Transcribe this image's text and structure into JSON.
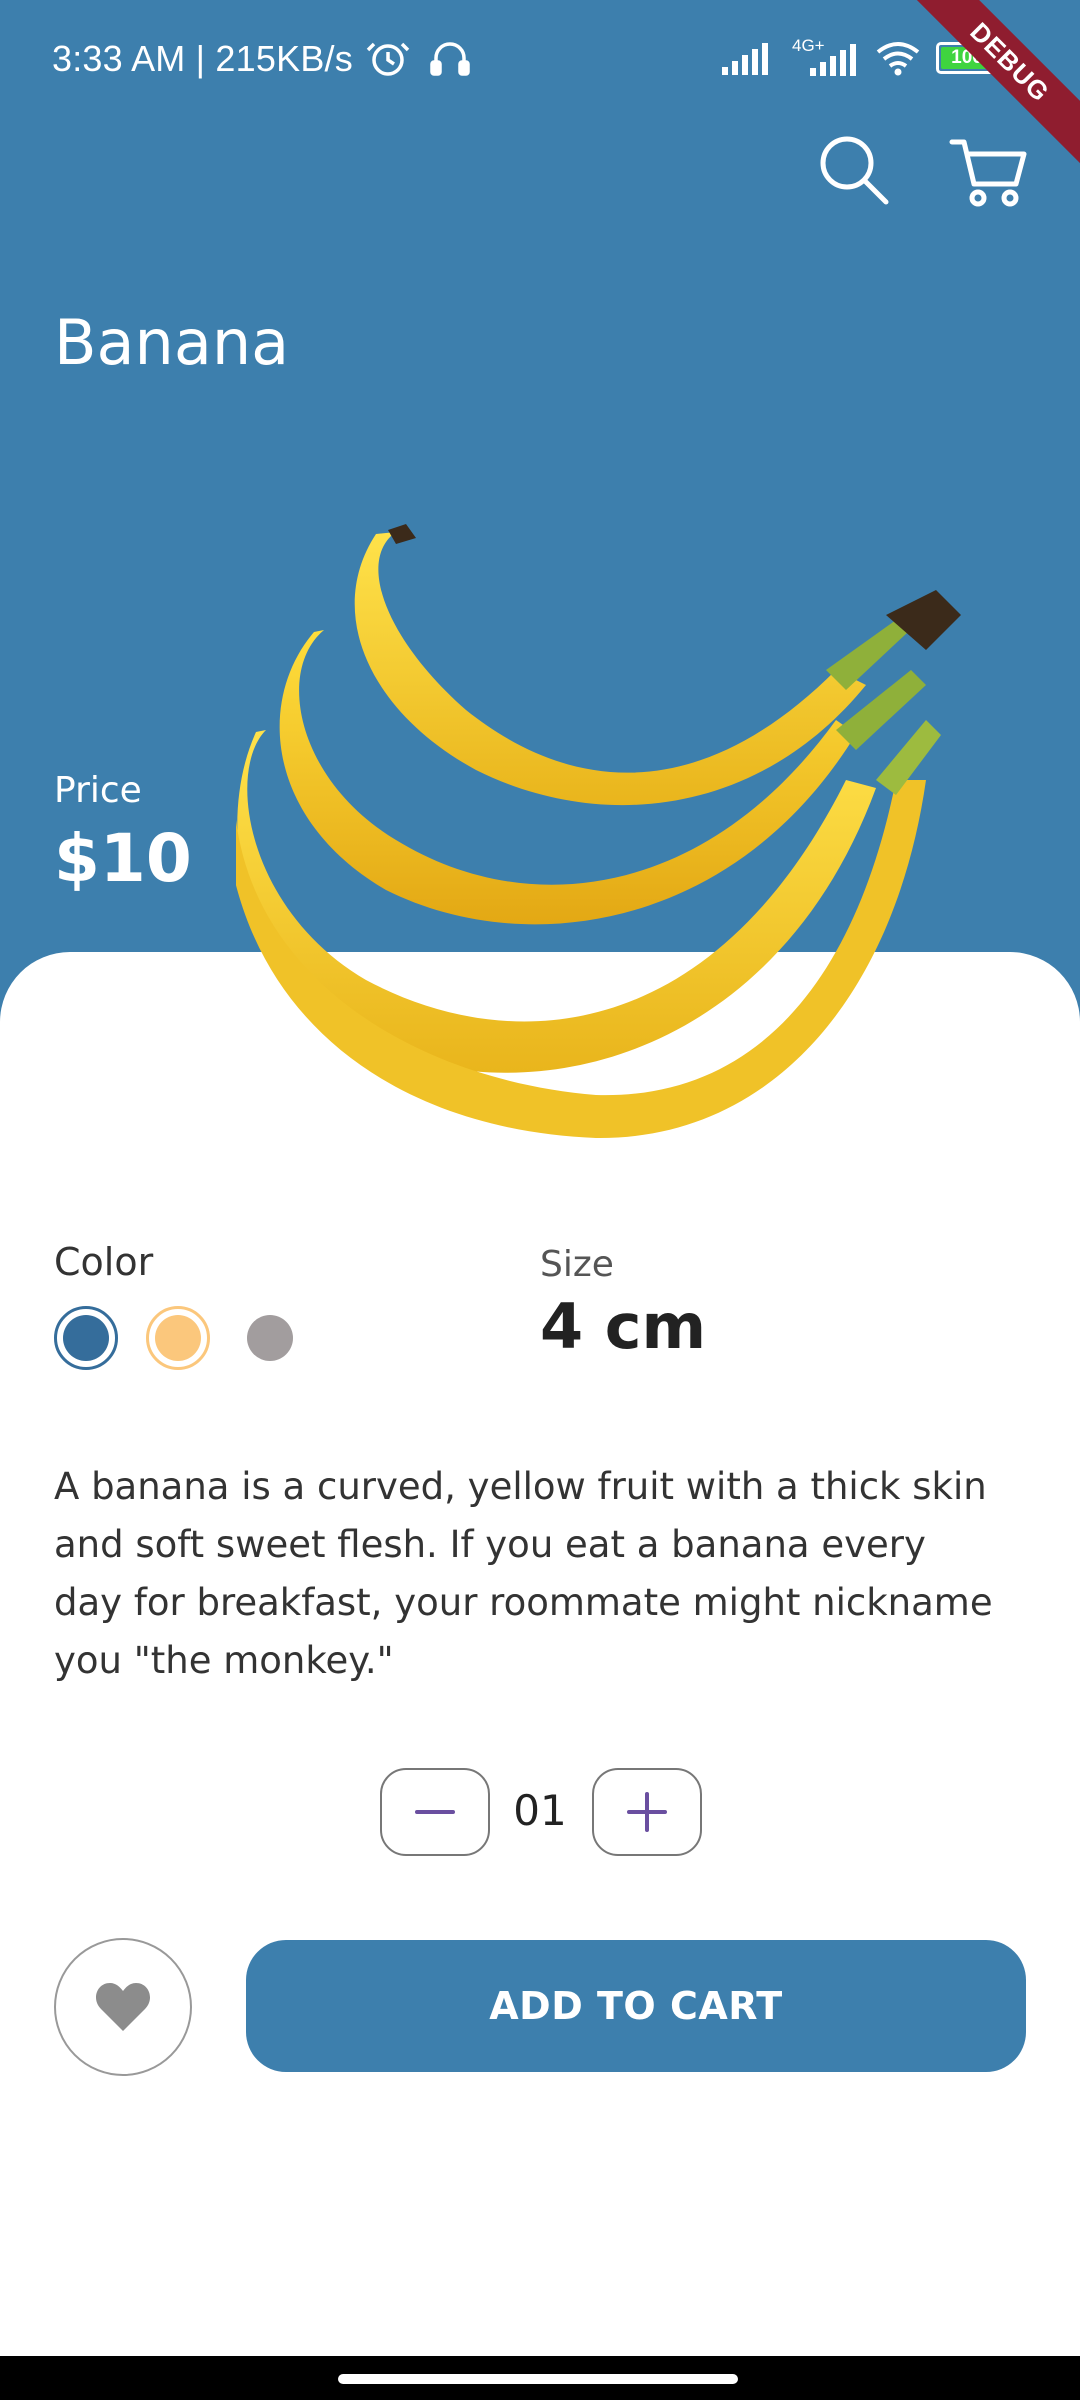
{
  "status_bar": {
    "time_speed": "3:33 AM | 215KB/s",
    "network": "4G+",
    "battery": "100",
    "debug_banner": "DEBUG"
  },
  "product": {
    "title": "Banana",
    "price_label": "Price",
    "price_value": "$10",
    "color_label": "Color",
    "colors": [
      "#356d9b",
      "#fbc77c",
      "#a29d9e"
    ],
    "selected_color_index": 0,
    "size_label": "Size",
    "size_value": "4 cm",
    "description": "A banana is a curved, yellow fruit with a thick skin and soft sweet flesh. If you eat a banana every day for breakfast, your roommate might nickname you \"the monkey.\"",
    "quantity": "01"
  },
  "actions": {
    "add_to_cart": "ADD TO CART"
  },
  "icons": {
    "search": "search-icon",
    "cart": "cart-icon",
    "favorite": "heart-icon",
    "decrement": "minus-icon",
    "increment": "plus-icon"
  },
  "theme": {
    "primary": "#3d7fad",
    "accent": "#6a4fa0"
  }
}
